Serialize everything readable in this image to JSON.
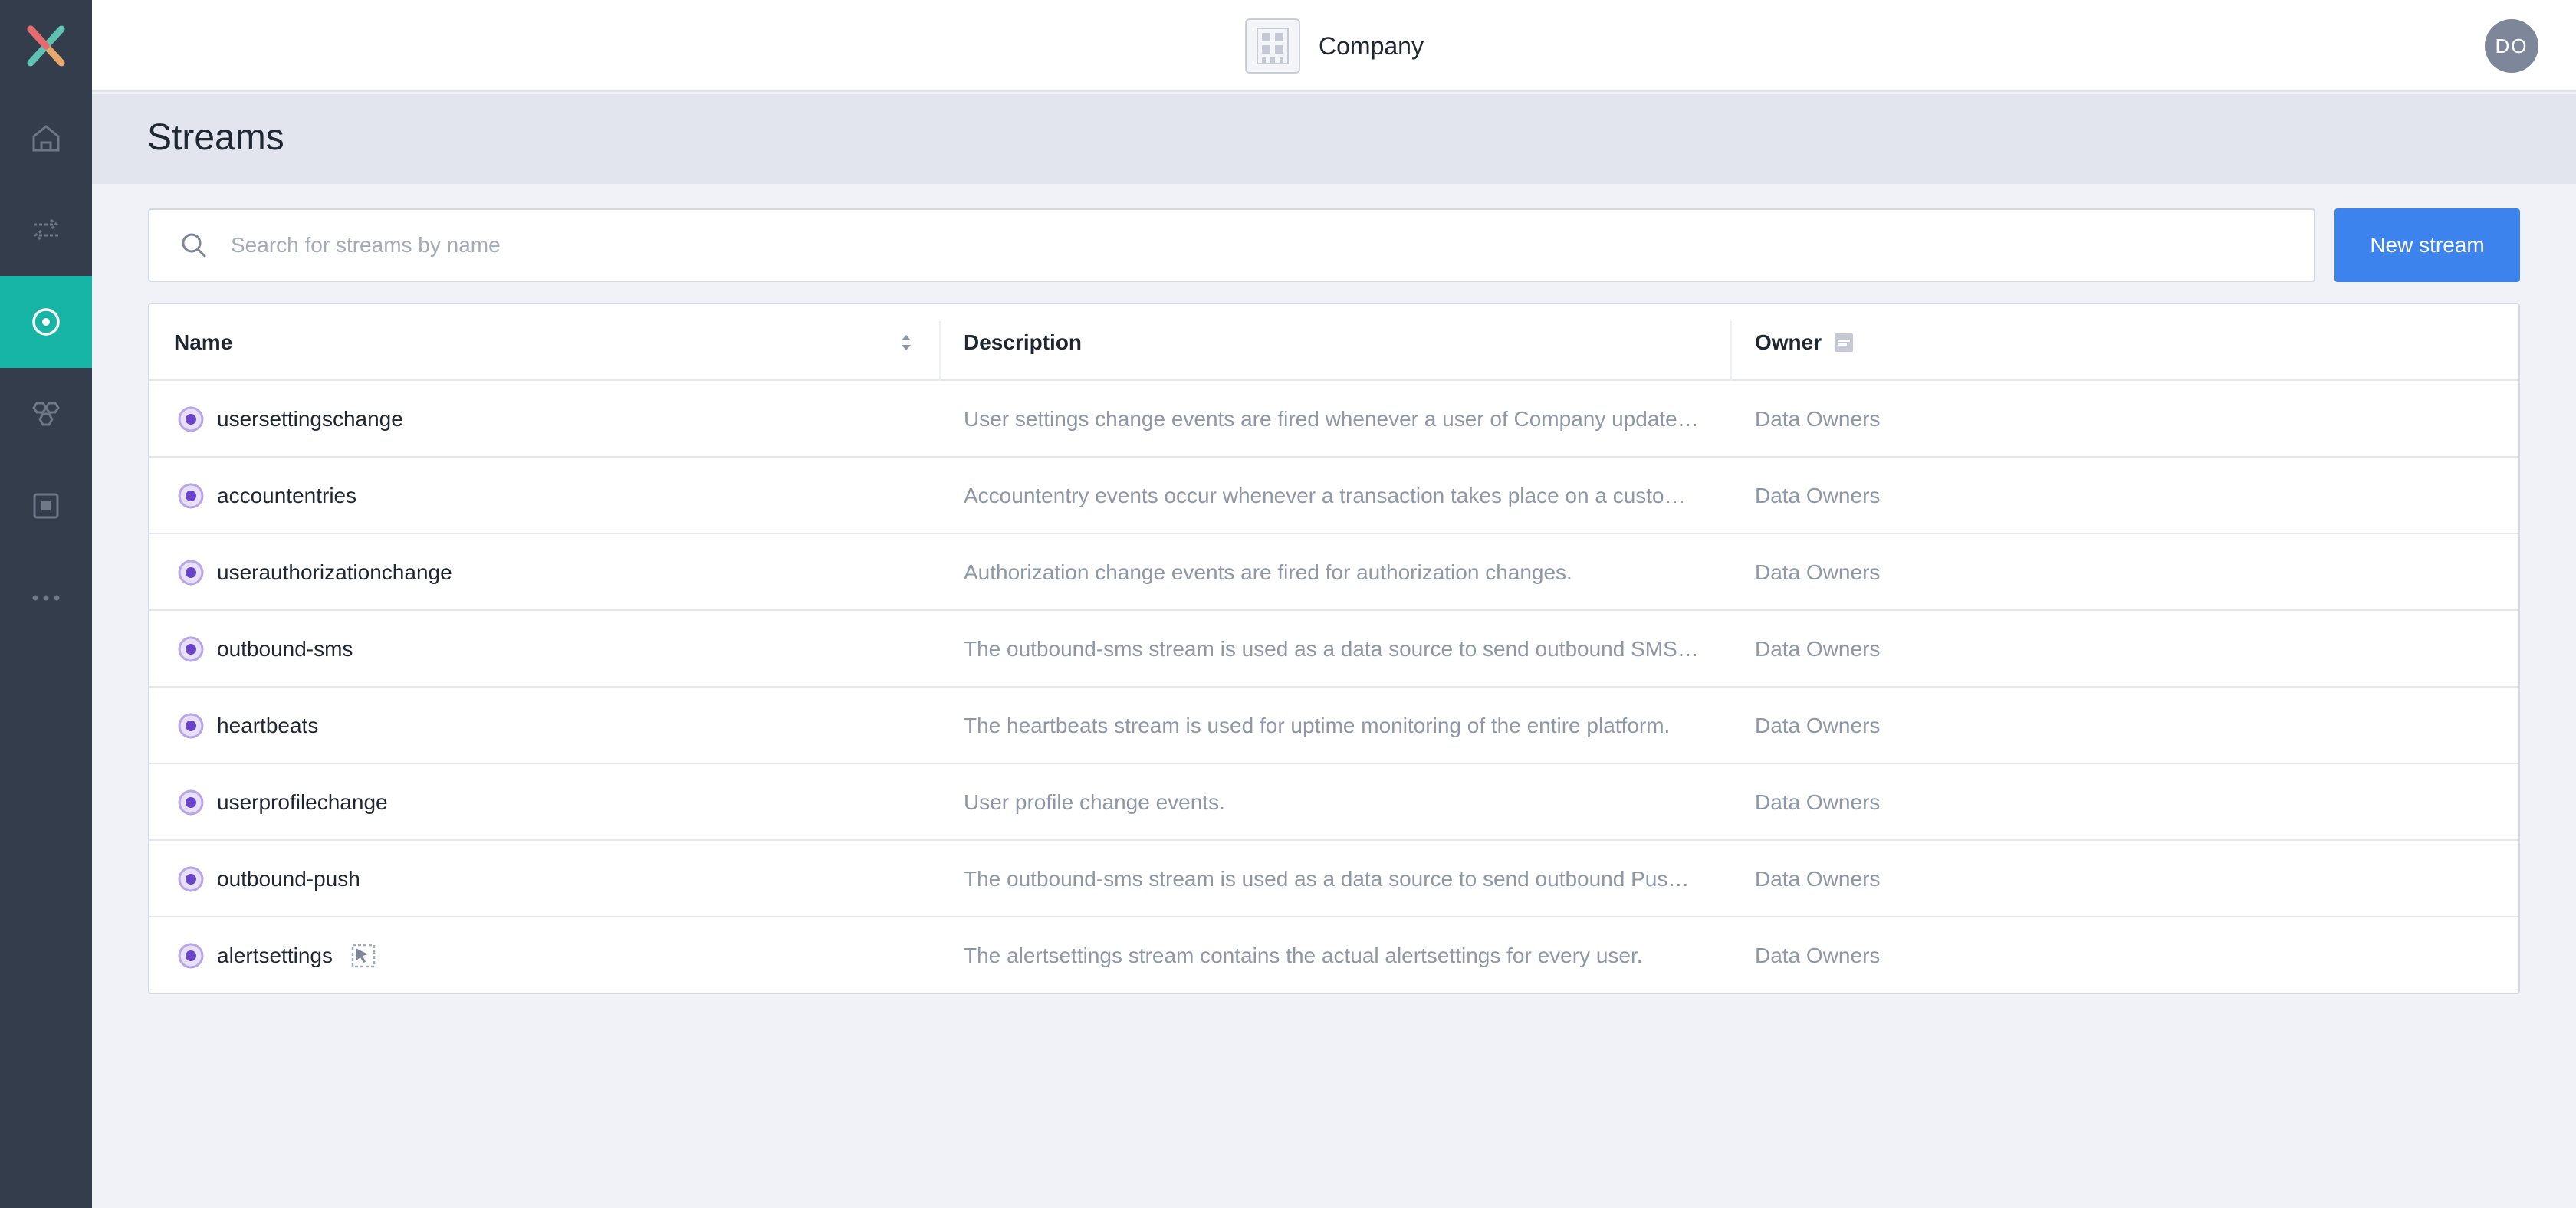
{
  "app": {
    "company_name": "Company",
    "user_initials": "DO"
  },
  "sidebar": {
    "items": [
      {
        "name": "home",
        "icon": "home-icon",
        "active": false
      },
      {
        "name": "pipelines",
        "icon": "arrows-icon",
        "active": false
      },
      {
        "name": "streams",
        "icon": "stream-target-icon",
        "active": true
      },
      {
        "name": "models",
        "icon": "hexagon-cluster-icon",
        "active": false
      },
      {
        "name": "blocks",
        "icon": "square-icon",
        "active": false
      },
      {
        "name": "more",
        "icon": "ellipsis-icon",
        "active": false
      }
    ]
  },
  "page": {
    "title": "Streams"
  },
  "search": {
    "placeholder": "Search for streams by name",
    "value": ""
  },
  "toolbar": {
    "new_stream_label": "New stream"
  },
  "table": {
    "headers": {
      "name": "Name",
      "description": "Description",
      "owner": "Owner"
    },
    "rows": [
      {
        "name": "usersettingschange",
        "description": "User settings change events are fired whenever a user of Company updated…",
        "owner": "Data Owners"
      },
      {
        "name": "accountentries",
        "description": "Accountentry events occur whenever a transaction takes place on a custom…",
        "owner": "Data Owners"
      },
      {
        "name": "userauthorizationchange",
        "description": "Authorization change events are fired for authorization changes.",
        "owner": "Data Owners"
      },
      {
        "name": "outbound-sms",
        "description": "The outbound-sms stream is used as a data source to send outbound SMS …",
        "owner": "Data Owners"
      },
      {
        "name": "heartbeats",
        "description": "The heartbeats stream is used for uptime monitoring of the entire platform.",
        "owner": "Data Owners"
      },
      {
        "name": "userprofilechange",
        "description": "User profile change events.",
        "owner": "Data Owners"
      },
      {
        "name": "outbound-push",
        "description": "The outbound-sms stream is used as a data source to send outbound Push …",
        "owner": "Data Owners"
      },
      {
        "name": "alertsettings",
        "description": "The alertsettings stream contains the actual alertsettings for every user.",
        "owner": "Data Owners"
      }
    ]
  },
  "colors": {
    "sidebar_bg": "#333d4b",
    "active_nav": "#17b5a6",
    "primary_button": "#3d83ee",
    "stream_icon": "#6b45c9"
  }
}
